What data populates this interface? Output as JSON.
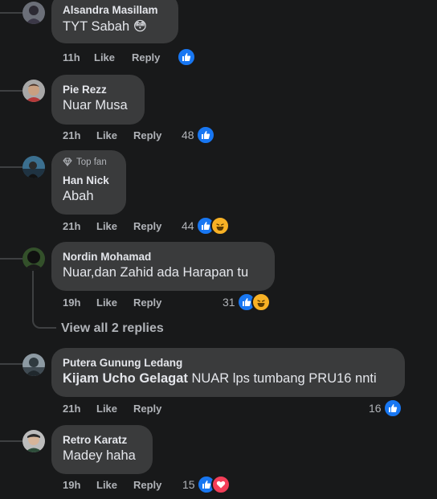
{
  "actions": {
    "like": "Like",
    "reply": "Reply"
  },
  "top_fan_label": "Top fan",
  "view_replies": "View all 2 replies",
  "comments": [
    {
      "author": "Alsandra Masillam",
      "text": "TYT Sabah 😳",
      "time": "11h",
      "count": "",
      "reactions": [
        "like"
      ]
    },
    {
      "author": "Pie Rezz",
      "text": "Nuar Musa",
      "time": "21h",
      "count": "48",
      "reactions": [
        "like"
      ]
    },
    {
      "author": "Han Nick",
      "text": "Abah",
      "time": "21h",
      "count": "44",
      "reactions": [
        "like",
        "haha"
      ],
      "badge": "Top fan"
    },
    {
      "author": "Nordin Mohamad",
      "text": "Nuar,dan Zahid ada Harapan tu",
      "time": "19h",
      "count": "31",
      "reactions": [
        "like",
        "haha"
      ]
    },
    {
      "author": "Putera Gunung Ledang",
      "mention": "Kijam Ucho Gelagat",
      "text": " NUAR lps tumbang PRU16 nnti",
      "time": "21h",
      "count": "16",
      "reactions": [
        "like"
      ]
    },
    {
      "author": "Retro Karatz",
      "text": "Madey haha",
      "time": "19h",
      "count": "15",
      "reactions": [
        "like",
        "love"
      ]
    }
  ],
  "colors": {
    "background": "#18191a",
    "bubble": "#3a3b3c",
    "like": "#1877f2",
    "haha": "#f7b125",
    "love": "#f33e58"
  }
}
